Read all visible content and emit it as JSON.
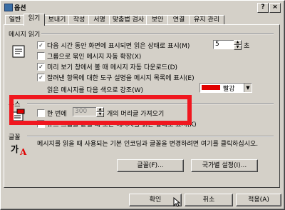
{
  "window": {
    "title": "옵션"
  },
  "tabs": [
    "일반",
    "읽기",
    "보내기",
    "작성",
    "서명",
    "맞춤법 검사",
    "보안",
    "연결",
    "유지 관리"
  ],
  "reading": {
    "section_label": "메시지 읽기",
    "opt1_label": "다음 시간 동안 화면에 표시되면 읽은 상태로 표시(M)",
    "opt1_value": "5",
    "opt1_unit": "초",
    "opt2_label": "그룹으로 묶인 메시지 자동 확장(X)",
    "opt3_label": "미리 보기 창에서 볼 때 메시지 자동 다운로드(D)",
    "opt4_label": "잘려낸 항목에 대한 도구 설명을 메시지 목록에 표시(E)",
    "highlight_label": "읽은 메시지를 다음 색으로 강조(W)",
    "highlight_color_name": "빨강",
    "highlight_color": "#e00000"
  },
  "news": {
    "section_label": "뉴스",
    "fetch_prefix": "한 번에",
    "fetch_value": "300",
    "fetch_suffix": "개의 머리글 가져오기",
    "opt2_label": "뉴스 그룹을 끝낼 때 모든 메시지를 읽은 상태로 표시(K)"
  },
  "fonts": {
    "section_label": "글꼴",
    "description": "메시지를 읽을 때 사용되는 기본 인코딩과 글꼴을 변경하려면 여기를 클릭하십시오.",
    "fonts_button": "글꼴(F)...",
    "intl_button": "국가별 설정(I)..."
  },
  "footer": {
    "ok": "확인",
    "cancel": "취소",
    "apply": "적용(A)"
  },
  "colors": {
    "annotation": "#f0171f"
  }
}
